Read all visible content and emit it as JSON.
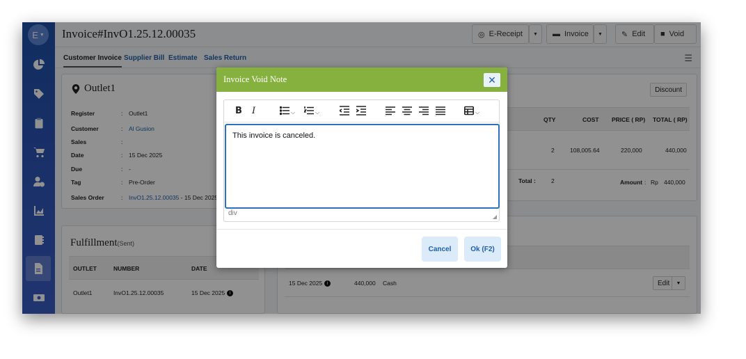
{
  "header": {
    "avatar_letter": "E",
    "title": "Invoice#InvO1.25.12.00035",
    "buttons": {
      "ereceipt": "E-Receipt",
      "invoice": "Invoice",
      "edit": "Edit",
      "void": "Void"
    }
  },
  "tabs": [
    {
      "label": "Customer Invoice",
      "active": true
    },
    {
      "label": "Supplier Bill"
    },
    {
      "label": "Estimate"
    },
    {
      "label": "Sales Return"
    }
  ],
  "outlet_card": {
    "title": "Outlet1",
    "rows": [
      {
        "key": "Register",
        "value": "Outlet1"
      },
      {
        "key": "Customer",
        "value": "Al Gusion"
      },
      {
        "key": "Sales",
        "value": ""
      },
      {
        "key": "Date",
        "value": "15 Dec 2025"
      },
      {
        "key": "Due",
        "value": "-"
      },
      {
        "key": "Tag",
        "value": "Pre-Order"
      },
      {
        "key": "Sales Order",
        "value": "InvO1.25.12.00035",
        "suffix": "- 15 Dec 2025"
      }
    ]
  },
  "items_card": {
    "discount_label": "Discount",
    "columns": [
      "QTY",
      "COST",
      "PRICE ( RP)",
      "TOTAL ( RP)"
    ],
    "row": {
      "qty": "2",
      "cost": "108,005.64",
      "price": "220,000",
      "total": "440,000"
    },
    "total_label": "Total :",
    "total_qty": "2",
    "amount_label": "Amount",
    "amount_currency": "Rp",
    "amount_value": "440,000"
  },
  "fulfillment": {
    "title": "Fulfillment",
    "status": "(Sent)",
    "columns": [
      "OUTLET",
      "NUMBER",
      "DATE"
    ],
    "row": {
      "outlet": "Outlet1",
      "number": "InvO1.25.12.00035",
      "date": "15 Dec 2025"
    }
  },
  "payment": {
    "date": "15 Dec 2025",
    "amount": "440,000",
    "method": "Cash",
    "edit_label": "Edit"
  },
  "modal": {
    "title": "Invoice Void Note",
    "content": "This invoice is canceled.",
    "status_path": "div",
    "cancel_label": "Cancel",
    "ok_label": "Ok (F2)",
    "close_glyph": "✕"
  },
  "colors": {
    "sidebar": "#2a55b5",
    "modal_header": "#86b13f",
    "link": "#1f5fa8",
    "focus": "#2b6fc2"
  }
}
